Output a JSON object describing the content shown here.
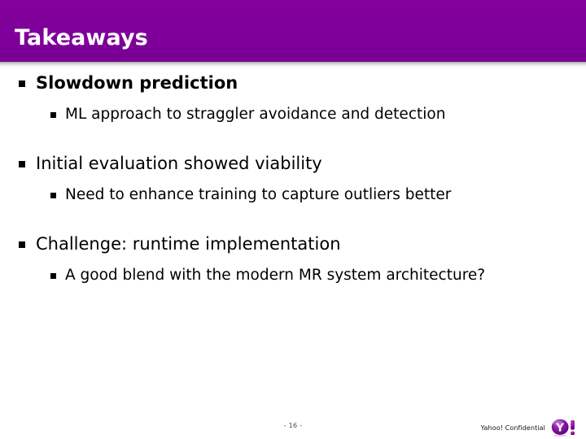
{
  "slide": {
    "title": "Takeaways",
    "header_color": "#7e0099",
    "title_color": "#ffffff",
    "bullet_groups": [
      {
        "level1": "Slowdown prediction",
        "level1_bold": true,
        "level2": "ML approach to straggler avoidance and detection"
      },
      {
        "level1": "Initial evaluation showed viability",
        "level1_bold": false,
        "level2": "Need to enhance training to capture outliers better"
      },
      {
        "level1": "Challenge: runtime implementation",
        "level1_bold": false,
        "level2": "A good blend with the modern MR system architecture?"
      }
    ]
  },
  "footer": {
    "page_number": "- 16 -",
    "confidential": "Yahoo! Confidential",
    "logo_letter": "Y",
    "logo_bang": "!",
    "logo_color": "#7b0099"
  }
}
